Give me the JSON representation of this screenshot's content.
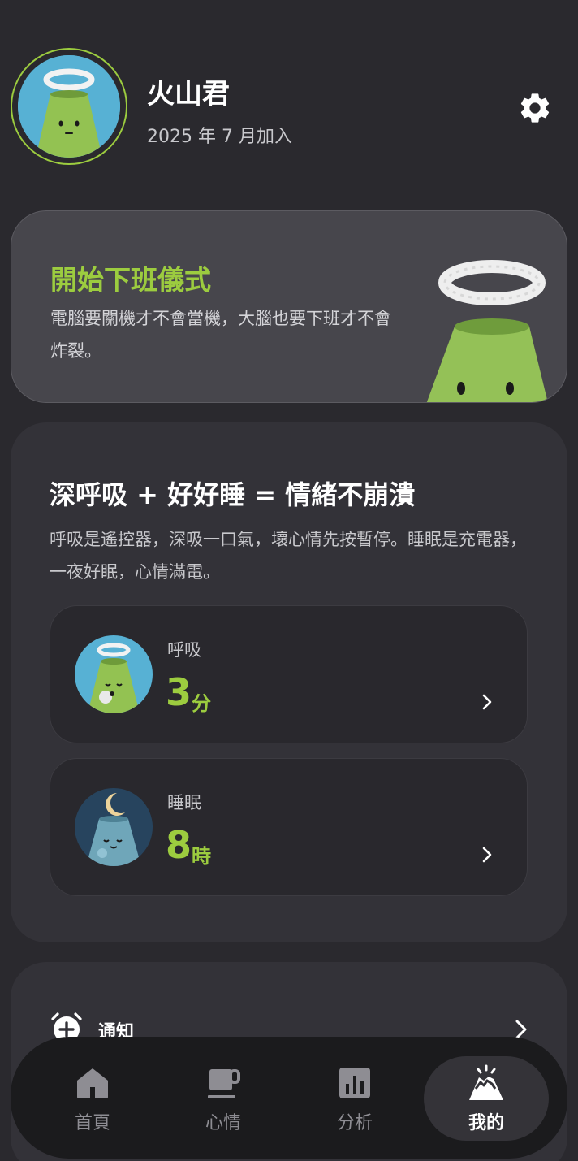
{
  "profile": {
    "name": "火山君",
    "joined": "2025 年 7 月加入",
    "avatar_icon": "volcano-mascot-avatar",
    "settings_icon": "gear-icon"
  },
  "ritual": {
    "title": "開始下班儀式",
    "description": "電腦要關機才不會當機，大腦也要下班才不會炸裂。",
    "art_icon": "volcano-mascot-with-halo"
  },
  "wellness": {
    "title": "深呼吸 + 好好睡 = 情緒不崩潰",
    "description": "呼吸是遙控器，深吸一口氣，壞心情先按暫停。睡眠是充電器，一夜好眠，心情滿電。",
    "breath": {
      "label": "呼吸",
      "value": "3",
      "unit": "分",
      "icon": "breathing-volcano-icon"
    },
    "sleep": {
      "label": "睡眠",
      "value": "8",
      "unit": "時",
      "icon": "sleeping-volcano-moon-icon"
    }
  },
  "settings_list": {
    "notify": {
      "label": "通知",
      "icon": "alarm-clock-add-icon"
    }
  },
  "nav": {
    "items": [
      {
        "label": "首頁",
        "icon": "home-icon"
      },
      {
        "label": "心情",
        "icon": "coffee-cup-icon"
      },
      {
        "label": "分析",
        "icon": "bar-chart-icon"
      },
      {
        "label": "我的",
        "icon": "volcano-icon"
      }
    ],
    "active_index": 3
  },
  "colors": {
    "accent": "#9ccc3f",
    "background": "#2a292e",
    "card": "#333238",
    "nav_bg": "#1b1b1d"
  }
}
